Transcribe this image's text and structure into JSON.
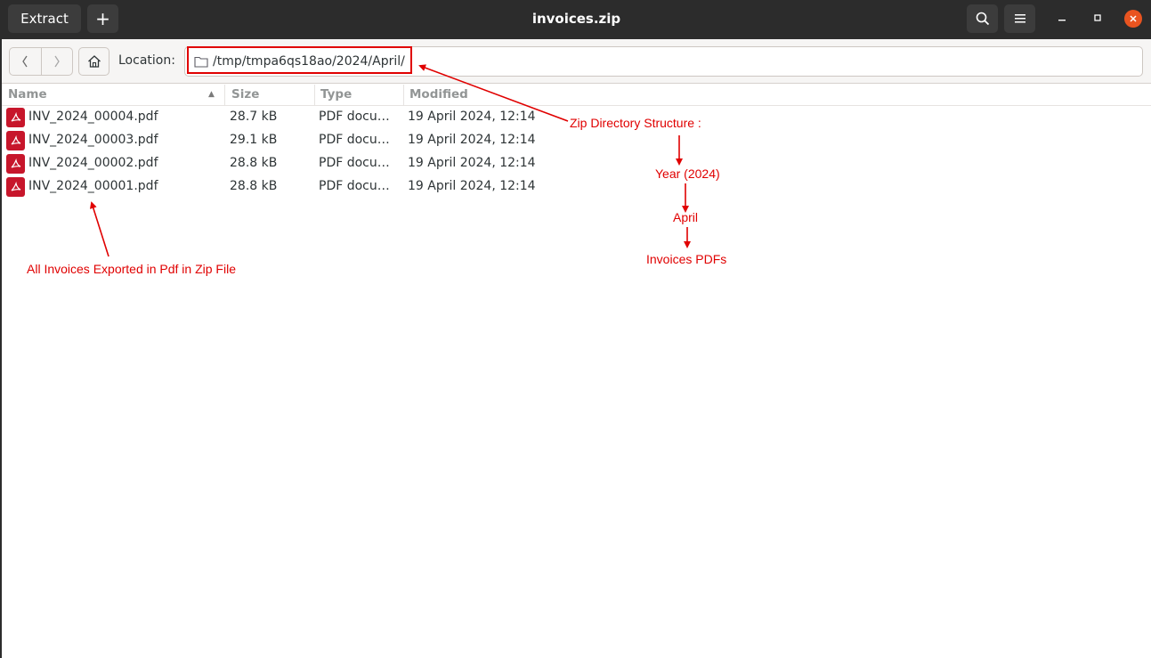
{
  "window": {
    "title": "invoices.zip",
    "extract_label": "Extract",
    "add_label": "+"
  },
  "location": {
    "label": "Location:",
    "path": "/tmp/tmpa6qs18ao/2024/April/"
  },
  "columns": {
    "name": "Name",
    "size": "Size",
    "type": "Type",
    "modified": "Modified"
  },
  "files": [
    {
      "name": "INV_2024_00004.pdf",
      "size": "28.7 kB",
      "type": "PDF document",
      "modified": "19 April 2024, 12:14"
    },
    {
      "name": "INV_2024_00003.pdf",
      "size": "29.1 kB",
      "type": "PDF document",
      "modified": "19 April 2024, 12:14"
    },
    {
      "name": "INV_2024_00002.pdf",
      "size": "28.8 kB",
      "type": "PDF document",
      "modified": "19 April 2024, 12:14"
    },
    {
      "name": "INV_2024_00001.pdf",
      "size": "28.8 kB",
      "type": "PDF document",
      "modified": "19 April 2024, 12:14"
    }
  ],
  "annotations": {
    "structure_title": "Zip Directory Structure :",
    "year": "Year (2024)",
    "month": "April",
    "pdfs": "Invoices PDFs",
    "export_note": "All Invoices Exported in Pdf in Zip File"
  },
  "colors": {
    "accent": "#e95420",
    "annotation": "#e00000",
    "pdf_icon": "#c7162b"
  }
}
